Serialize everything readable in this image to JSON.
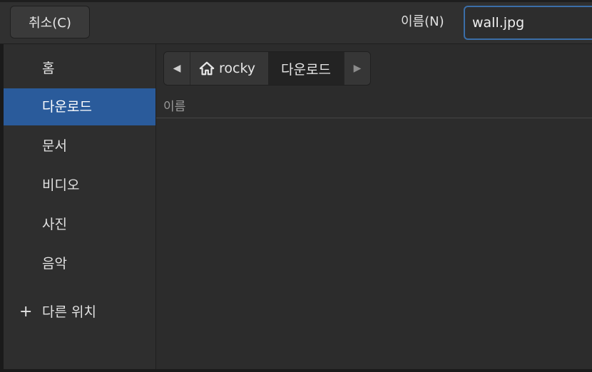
{
  "header": {
    "cancel_label": "취소(C)",
    "name_label": "이름(N)",
    "filename_value": "wall.jpg"
  },
  "sidebar": {
    "items": [
      {
        "label": "홈",
        "active": false
      },
      {
        "label": "다운로드",
        "active": true
      },
      {
        "label": "문서",
        "active": false
      },
      {
        "label": "비디오",
        "active": false
      },
      {
        "label": "사진",
        "active": false
      },
      {
        "label": "음악",
        "active": false
      }
    ],
    "other_locations": {
      "label": "다른 위치",
      "icon": "plus-icon"
    }
  },
  "pathbar": {
    "home_crumb": {
      "label": "rocky",
      "icon": "home-icon"
    },
    "current_crumb": {
      "label": "다운로드"
    }
  },
  "file_list": {
    "column_header": "이름",
    "rows": []
  },
  "colors": {
    "accent": "#2a5b9b",
    "input_border": "#3b6ea8",
    "background": "#2c2c2c"
  }
}
